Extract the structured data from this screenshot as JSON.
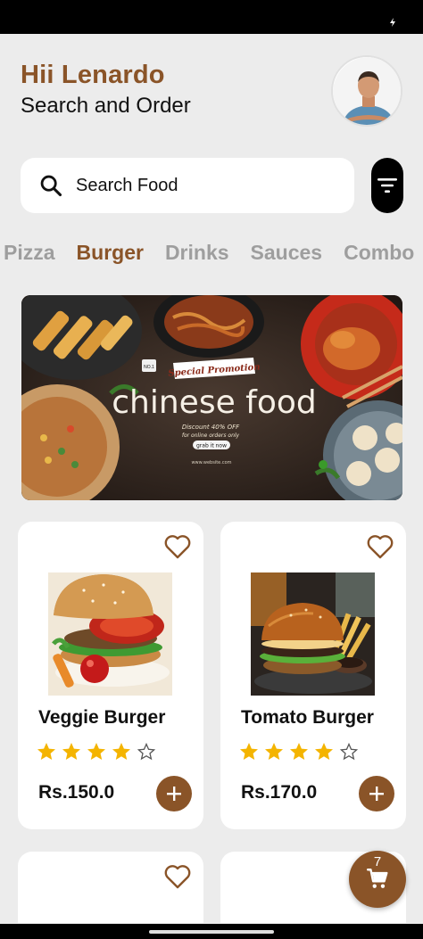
{
  "header": {
    "greeting": "Hii Lenardo",
    "subtitle": "Search and Order"
  },
  "search": {
    "placeholder": "Search Food"
  },
  "categories": [
    {
      "label": "Pizza",
      "active": false
    },
    {
      "label": "Burger",
      "active": true
    },
    {
      "label": "Drinks",
      "active": false
    },
    {
      "label": "Sauces",
      "active": false
    },
    {
      "label": "Combo",
      "active": false
    }
  ],
  "banner": {
    "badge": "Special Promotion",
    "title": "chinese food",
    "discount": "Discount 40% OFF",
    "note": "for online orders only",
    "cta": "grab it now",
    "fine_print": "www.website.com",
    "tag": "NO.1"
  },
  "products": [
    {
      "name": "Veggie Burger",
      "rating": 4,
      "max_rating": 5,
      "price": "Rs.150.0"
    },
    {
      "name": "Tomato Burger",
      "rating": 4,
      "max_rating": 5,
      "price": "Rs.170.0"
    }
  ],
  "cart": {
    "count": "7"
  },
  "colors": {
    "accent": "#8a5428",
    "star": "#f4b400",
    "inactive": "#9e9e9e"
  }
}
